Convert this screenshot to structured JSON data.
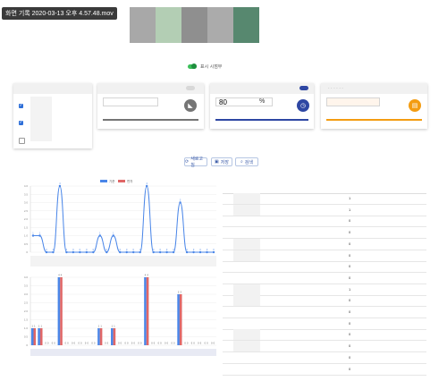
{
  "recording_caption": "화면 기록 2020-03-13 오후 4.57.48.mov",
  "color_swatches": [
    {
      "name": "swatch-1",
      "color": "#a8a8a8"
    },
    {
      "name": "swatch-2",
      "color": "#b3ceb4"
    },
    {
      "name": "swatch-3",
      "color": "#8f8f8f"
    },
    {
      "name": "swatch-4",
      "color": "#ababab"
    },
    {
      "name": "swatch-5",
      "color": "#57886f"
    }
  ],
  "toggle": {
    "label": "표시 시점부",
    "on_color": "#3cbf5a"
  },
  "cards": [
    {
      "header": "",
      "value": "",
      "unit": "",
      "accent": "#757575",
      "icon": "slope-icon",
      "switch": "off"
    },
    {
      "header": "",
      "value": "80",
      "unit": "%",
      "accent": "#2e47a3",
      "icon": "clock-icon",
      "switch": "on"
    },
    {
      "header": "· · · · · ·",
      "value": "",
      "unit": "",
      "accent": "#f39c12",
      "icon": "calendar-icon",
      "switch": "none"
    }
  ],
  "action_buttons": [
    {
      "label": "새로고침",
      "icon": "refresh-icon"
    },
    {
      "label": "저장",
      "icon": "save-icon"
    },
    {
      "label": "검색",
      "icon": "search-icon"
    }
  ],
  "checkboxes": [
    true,
    true,
    false
  ],
  "chart_data": [
    {
      "type": "line",
      "legend": [
        "기준",
        "편차"
      ],
      "legend_colors": [
        "#4a86e8",
        "#e06666"
      ],
      "ylim": [
        0,
        4
      ],
      "yticks": [
        "4.0",
        "3.5",
        "3.0",
        "2.5",
        "2.0",
        "1.5",
        "1.0",
        "0.5",
        "0"
      ],
      "series": [
        {
          "values": [
            1,
            1,
            0,
            0,
            4,
            0,
            0,
            0,
            0,
            0,
            1,
            0,
            1,
            0,
            0,
            0,
            0,
            4,
            0,
            0,
            0,
            0,
            3,
            0,
            0,
            0,
            0,
            0
          ]
        }
      ]
    },
    {
      "type": "bar",
      "ylim": [
        0,
        4
      ],
      "yticks": [
        "4.0",
        "3.5",
        "3.0",
        "2.5",
        "2.0",
        "1.5",
        "1.0",
        "0.5",
        "0"
      ],
      "series": [
        {
          "color": "#4a86e8",
          "values": [
            1,
            1,
            0,
            0,
            4,
            0,
            0,
            0,
            0,
            0,
            1,
            0,
            1,
            0,
            0,
            0,
            0,
            4,
            0,
            0,
            0,
            0,
            3,
            0,
            0,
            0,
            0,
            0
          ]
        },
        {
          "color": "#e06666",
          "values": [
            1,
            1,
            0,
            0,
            4,
            0,
            0,
            0,
            0,
            0,
            1,
            0,
            1,
            0,
            0,
            0,
            0,
            4,
            0,
            0,
            0,
            0,
            3,
            0,
            0,
            0,
            0,
            0
          ]
        }
      ]
    }
  ],
  "table": {
    "rows": [
      {
        "label": "",
        "value": "1"
      },
      {
        "label": "",
        "value": "1"
      },
      {
        "label": "",
        "value": "0"
      },
      {
        "label": "",
        "value": "0"
      },
      {
        "label": "",
        "value": "0"
      },
      {
        "label": "",
        "value": "0"
      },
      {
        "label": "",
        "value": "0"
      },
      {
        "label": "",
        "value": "0"
      },
      {
        "label": "",
        "value": "1"
      },
      {
        "label": "",
        "value": "0"
      },
      {
        "label": "",
        "value": "0"
      },
      {
        "label": "",
        "value": "0"
      },
      {
        "label": "",
        "value": "0"
      },
      {
        "label": "",
        "value": "0"
      },
      {
        "label": "",
        "value": "0"
      },
      {
        "label": "",
        "value": "0"
      }
    ]
  }
}
